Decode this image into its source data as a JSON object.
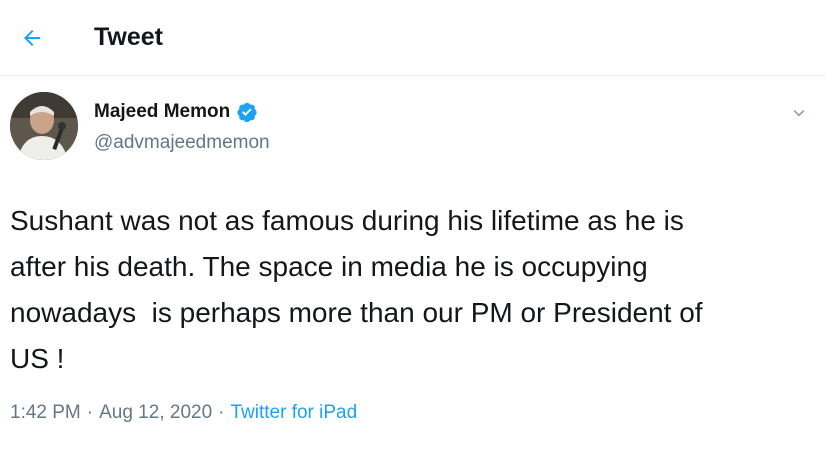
{
  "header": {
    "back_icon": "arrow-left-icon",
    "title": "Tweet"
  },
  "tweet": {
    "author": {
      "display_name": "Majeed Memon",
      "handle": "@advmajeedmemon",
      "verified_icon": "verified-badge-icon"
    },
    "menu_icon": "chevron-down-icon",
    "text": "Sushant was not as famous during his lifetime as he is\nafter his death. The space in media he is occupying\nnowadays  is perhaps more than our PM or President of\nUS !",
    "time": "1:42 PM",
    "separator": "·",
    "date": "Aug 12, 2020",
    "source": "Twitter for iPad"
  },
  "colors": {
    "accent": "#1da1f2",
    "text": "#14171a",
    "secondary": "#657786",
    "border": "#e6ecf0"
  }
}
